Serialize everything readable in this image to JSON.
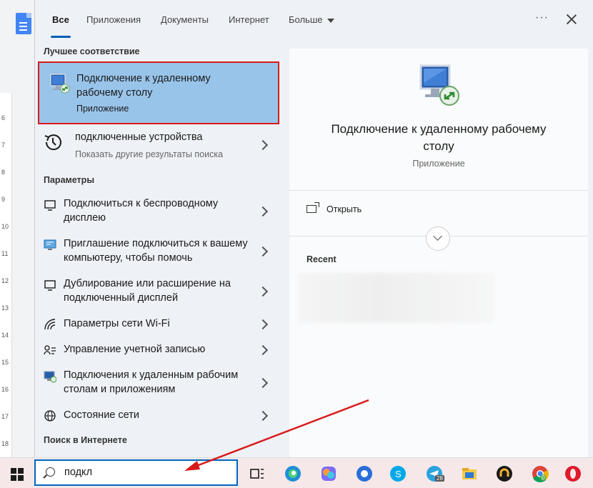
{
  "tabs": {
    "all": "Все",
    "apps": "Приложения",
    "docs": "Документы",
    "web": "Интернет",
    "more": "Больше",
    "ellipsis": "···"
  },
  "ruler_numbers": [
    "6",
    "7",
    "8",
    "9",
    "10",
    "11",
    "12",
    "13",
    "14",
    "15",
    "16",
    "17",
    "18"
  ],
  "best_match": {
    "section": "Лучшее соответствие",
    "title": "Подключение к удаленному рабочему столу",
    "subtitle": "Приложение",
    "icon": "remote-desktop-icon"
  },
  "suggestion": {
    "title": "подключенные устройства",
    "subtitle": "Показать другие результаты поиска",
    "icon": "history-icon"
  },
  "settings": {
    "section": "Параметры",
    "items": [
      {
        "label": "Подключиться к беспроводному дисплею",
        "icon": "monitor-icon"
      },
      {
        "label": "Приглашение подключиться к вашему компьютеру, чтобы помочь",
        "icon": "remote-assist-icon"
      },
      {
        "label": "Дублирование или расширение на подключенный дисплей",
        "icon": "monitor-icon"
      },
      {
        "label": "Параметры сети Wi-Fi",
        "icon": "wifi-icon"
      },
      {
        "label": "Управление учетной записью",
        "icon": "account-icon"
      },
      {
        "label": "Подключения к удаленным рабочим столам и приложениям",
        "icon": "remote-connections-icon"
      },
      {
        "label": "Состояние сети",
        "icon": "globe-icon"
      }
    ]
  },
  "web_section": "Поиск в Интернете",
  "detail": {
    "title": "Подключение к удаленному рабочему столу",
    "subtitle": "Приложение",
    "open_label": "Открыть",
    "recent_label": "Recent"
  },
  "taskbar": {
    "search_value": "подкл",
    "telegram_badge": "28",
    "chrome_badge": "0"
  },
  "colors": {
    "accent": "#005fb8",
    "highlight": "#99c4ea",
    "annotation": "#d81a1a"
  }
}
